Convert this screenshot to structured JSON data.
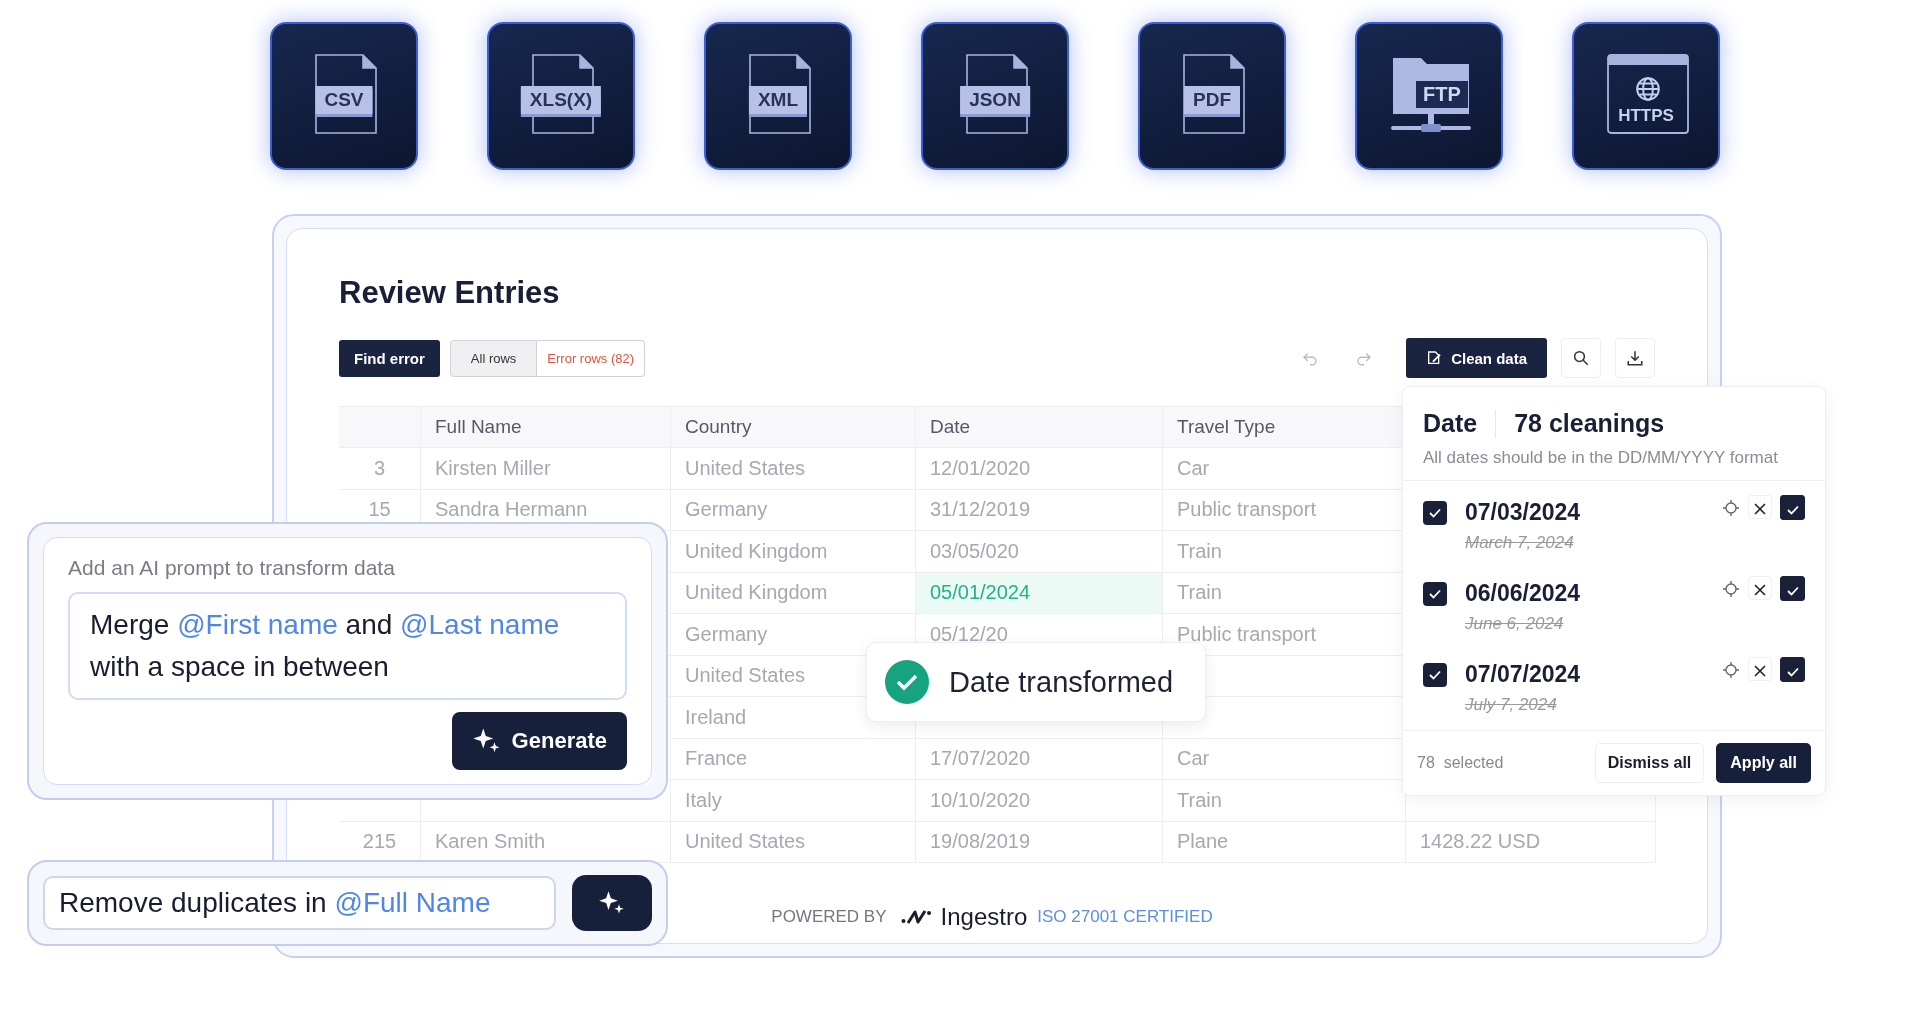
{
  "sources": [
    {
      "kind": "file",
      "label": "CSV"
    },
    {
      "kind": "file",
      "label": "XLS(X)"
    },
    {
      "kind": "file",
      "label": "XML"
    },
    {
      "kind": "file",
      "label": "JSON"
    },
    {
      "kind": "file",
      "label": "PDF"
    },
    {
      "kind": "folder",
      "label": "FTP"
    },
    {
      "kind": "browser",
      "label": "HTTPS"
    }
  ],
  "review": {
    "title": "Review Entries",
    "find_error": "Find error",
    "filters": [
      {
        "label": "All rows",
        "selected": true,
        "kind": "normal"
      },
      {
        "label": "Error rows (82)",
        "selected": false,
        "kind": "error"
      }
    ],
    "clean_data": "Clean data"
  },
  "table": {
    "columns": [
      "Full Name",
      "Country",
      "Date",
      "Travel Type"
    ],
    "rows": [
      {
        "index": "3",
        "full_name": "Kirsten Miller",
        "country": "United States",
        "date": "12/01/2020",
        "date_highlighted": false,
        "travel_type": "Car"
      },
      {
        "index": "15",
        "full_name": "Sandra Hermann",
        "country": "Germany",
        "date": "31/12/2019",
        "date_highlighted": false,
        "travel_type": "Public transport"
      },
      {
        "country": "United Kingdom",
        "date": "03/05/020",
        "date_highlighted": false,
        "travel_type": "Train"
      },
      {
        "country": "United Kingdom",
        "date": "05/01/2024",
        "date_highlighted": true,
        "travel_type": "Train"
      },
      {
        "country": "Germany",
        "date": "05/12/20",
        "date_highlighted": false,
        "travel_type": "Public transport"
      },
      {
        "country": "United States"
      },
      {
        "country": "Ireland"
      },
      {
        "country": "France",
        "date": "17/07/2020",
        "date_highlighted": false,
        "travel_type": "Car"
      },
      {
        "country": "Italy",
        "date": "10/10/2020",
        "date_highlighted": false,
        "travel_type": "Train"
      },
      {
        "index": "215",
        "full_name": "Karen Smith",
        "country": "United States",
        "date": "19/08/2019",
        "date_highlighted": false,
        "travel_type": "Plane",
        "column_5": "1428.22 USD"
      }
    ]
  },
  "toast": {
    "text": "Date transformed"
  },
  "cleaning": {
    "column": "Date",
    "count": "78 cleanings",
    "hint": "All dates should be in the DD/MM/YYYY format",
    "items": [
      {
        "new": "07/03/2024",
        "old": "March 7, 2024",
        "checked": true,
        "accepted": true
      },
      {
        "new": "06/06/2024",
        "old": "June 6, 2024",
        "checked": true,
        "accepted": true
      },
      {
        "new": "07/07/2024",
        "old": "July 7, 2024",
        "checked": true,
        "accepted": true
      }
    ],
    "selected": "78  selected",
    "dismiss": "Dismiss all",
    "apply": "Apply all"
  },
  "prompt": {
    "label": "Add an AI prompt to transform data",
    "segments": [
      {
        "kind": "plain",
        "text": "Merge "
      },
      {
        "kind": "mention",
        "text": "@First name"
      },
      {
        "kind": "plain",
        "text": " and "
      },
      {
        "kind": "mention",
        "text": "@Last name"
      },
      {
        "kind": "plain",
        "text": " with a space in between"
      }
    ],
    "button": "Generate"
  },
  "quick_prompt": {
    "segments": [
      {
        "kind": "plain",
        "text": "Remove duplicates in "
      },
      {
        "kind": "mention",
        "text": "@Full Name"
      }
    ]
  },
  "footer": {
    "powered_by": "POWERED BY",
    "brand": "Ingestro",
    "certification": "ISO 27001 CERTIFIED"
  }
}
